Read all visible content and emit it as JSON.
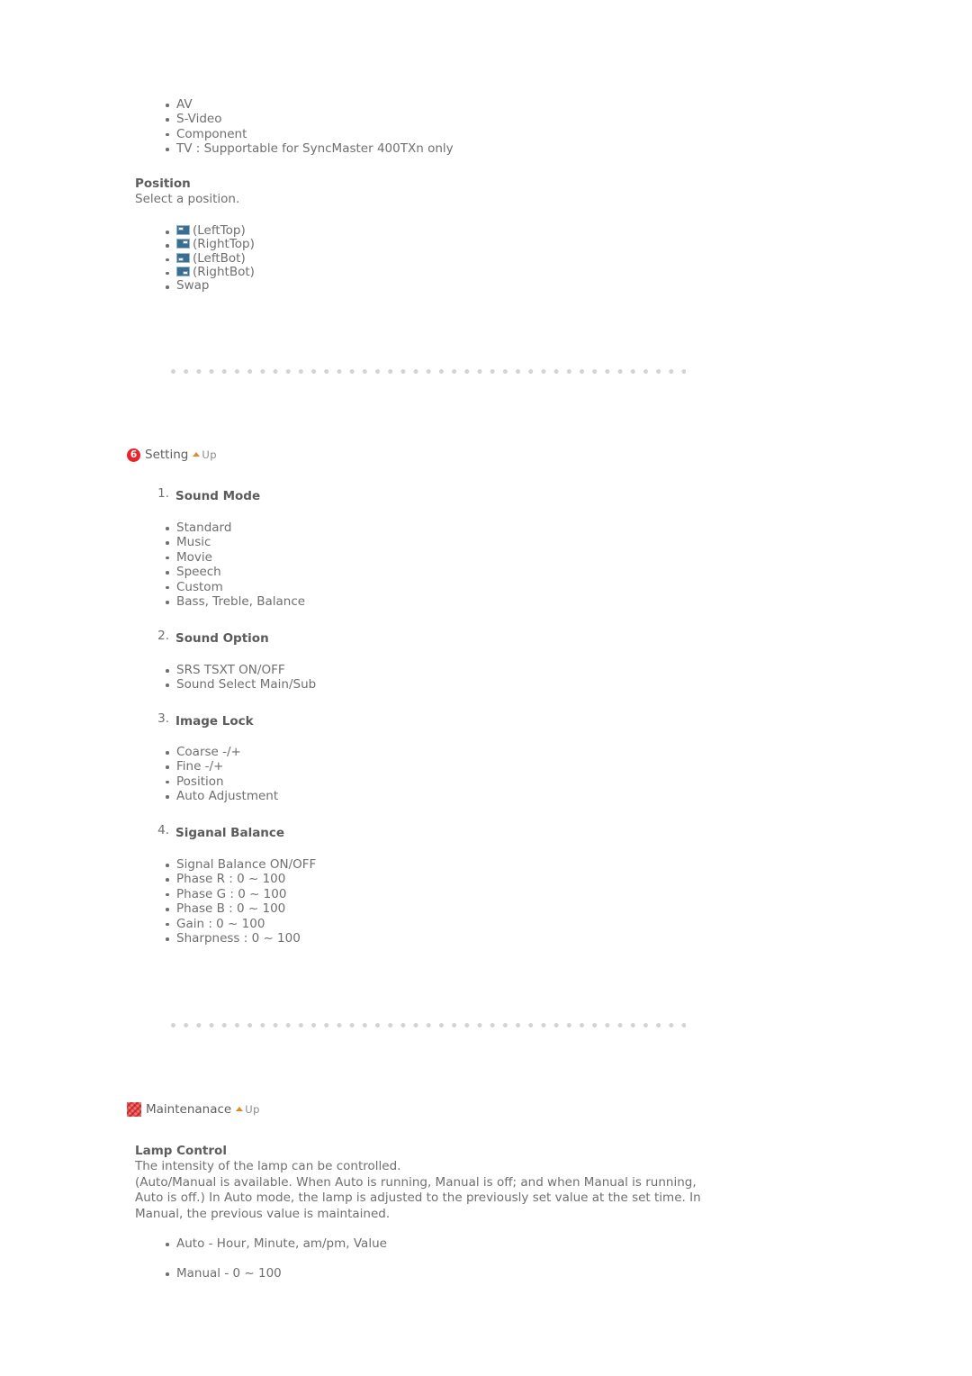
{
  "document": {
    "source_list": {
      "items": [
        "AV",
        "S-Video",
        "Component",
        "TV : Supportable for SyncMaster 400TXn only"
      ]
    },
    "position_section": {
      "heading": "Position",
      "description": "Select a position.",
      "options": [
        {
          "icon": "position-left-top-icon",
          "label": "(LeftTop)"
        },
        {
          "icon": "position-right-top-icon",
          "label": "(RightTop)"
        },
        {
          "icon": "position-left-bottom-icon",
          "label": "(LeftBot)"
        },
        {
          "icon": "position-right-bottom-icon",
          "label": "(RightBot)"
        }
      ],
      "swap_label": "Swap"
    },
    "setting_section": {
      "badge": "6",
      "title": "Setting",
      "up_label": "Up",
      "up_icon": "up-triangle-icon",
      "items": [
        {
          "number": "1.",
          "title": "Sound Mode",
          "bullets": [
            "Standard",
            "Music",
            "Movie",
            "Speech",
            "Custom",
            "Bass, Treble, Balance"
          ]
        },
        {
          "number": "2.",
          "title": "Sound Option",
          "bullets": [
            "SRS TSXT ON/OFF",
            "Sound Select Main/Sub"
          ]
        },
        {
          "number": "3.",
          "title": "Image Lock",
          "bullets": [
            "Coarse -/+",
            "Fine -/+",
            "Position",
            "Auto Adjustment"
          ]
        },
        {
          "number": "4.",
          "title": "Siganal Balance",
          "bullets": [
            "Signal Balance ON/OFF",
            "Phase R : 0 ~ 100",
            "Phase G : 0 ~ 100",
            "Phase B : 0 ~ 100",
            "Gain : 0 ~ 100",
            "Sharpness : 0 ~ 100"
          ]
        }
      ]
    },
    "maintenance_section": {
      "badge_icon": "maintenance-thumbnail-icon",
      "title": "Maintenanace",
      "up_label": "Up",
      "up_icon": "up-triangle-icon",
      "lamp_control": {
        "heading": "Lamp Control",
        "paragraph_1": "The intensity of the lamp can be controlled.",
        "paragraph_2": "(Auto/Manual is available. When Auto is running, Manual is off; and when Manual is running, Auto is off.) In Auto mode, the lamp is adjusted to the previously set value at the set time. In Manual, the previous value is maintained.",
        "bullets": [
          "Auto - Hour, Minute, am/pm, Value",
          "Manual - 0 ~ 100"
        ]
      }
    },
    "colors": {
      "text": "#6f6f6f",
      "heading": "#5b5b5b",
      "badge_red": "#e8232a",
      "up_arrow_orange": "#e08a2e",
      "icon_blue": "#386d94",
      "dot_rule_gray": "#d3d3d3"
    }
  }
}
